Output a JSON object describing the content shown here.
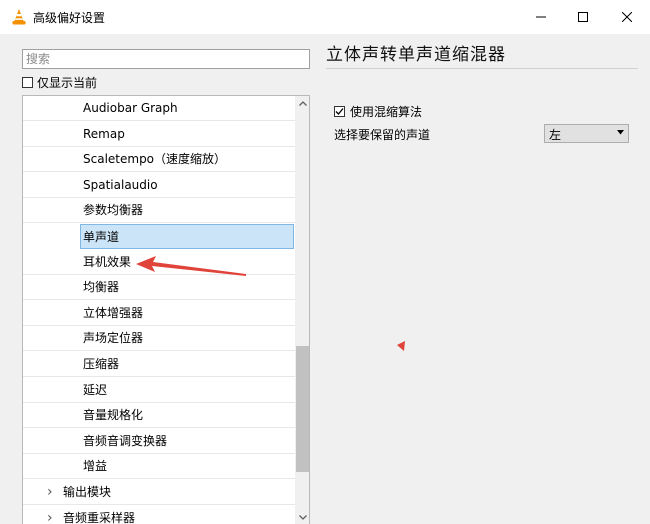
{
  "window": {
    "title": "高级偏好设置",
    "minimize_icon": "minimize-icon",
    "maximize_icon": "maximize-icon",
    "close_icon": "close-icon",
    "app_icon": "vlc-cone-icon"
  },
  "sidebar": {
    "search_placeholder": "搜索",
    "show_current_label": "仅显示当前",
    "show_current_checked": false,
    "tree_items": [
      {
        "label": "Audiobar Graph"
      },
      {
        "label": "Remap"
      },
      {
        "label": "Scaletempo（速度缩放）"
      },
      {
        "label": "Spatialaudio"
      },
      {
        "label": "参数均衡器"
      },
      {
        "label": "单声道",
        "selected": true
      },
      {
        "label": "耳机效果"
      },
      {
        "label": "均衡器"
      },
      {
        "label": "立体增强器"
      },
      {
        "label": "声场定位器"
      },
      {
        "label": "压缩器"
      },
      {
        "label": "延迟"
      },
      {
        "label": "音量规格化"
      },
      {
        "label": "音频音调变换器"
      },
      {
        "label": "增益"
      },
      {
        "label": "输出模块",
        "group": true
      },
      {
        "label": "音频重采样器",
        "group": true
      }
    ],
    "scrollbar_position": 0.86
  },
  "panel": {
    "title": "立体声转单声道缩混器",
    "compress_label": "使用混缩算法",
    "compress_checked": true,
    "channel_label": "选择要保留的声道",
    "channel_value": "左"
  },
  "colors": {
    "selection_bg": "#cce4f7",
    "selection_border": "#7fb8e6",
    "annotation_arrow": "#e0433a"
  }
}
